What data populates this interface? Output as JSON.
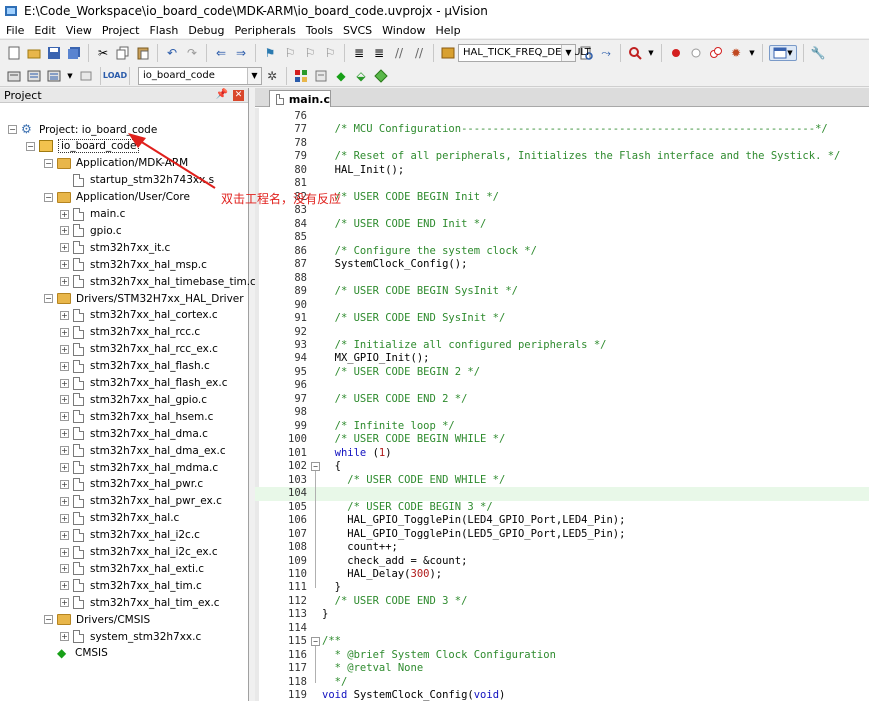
{
  "window": {
    "title": "E:\\Code_Workspace\\io_board_code\\MDK-ARM\\io_board_code.uvprojx - µVision"
  },
  "menu": [
    "File",
    "Edit",
    "View",
    "Project",
    "Flash",
    "Debug",
    "Peripherals",
    "Tools",
    "SVCS",
    "Window",
    "Help"
  ],
  "toolbar1": {
    "define_combo": "HAL_TICK_FREQ_DEFAULT"
  },
  "toolbar2": {
    "target_combo": "io_board_code"
  },
  "project_panel": {
    "title": "Project",
    "items": [
      {
        "label": "Project: io_board_code",
        "kind": "project",
        "level": 0,
        "expander": "−"
      },
      {
        "label": "io_board_code",
        "kind": "target",
        "level": 1,
        "expander": "−"
      },
      {
        "label": "Application/MDK-ARM",
        "kind": "folder",
        "level": 2,
        "expander": "−"
      },
      {
        "label": "startup_stm32h743xx.s",
        "kind": "file",
        "level": 3,
        "expander": ""
      },
      {
        "label": "Application/User/Core",
        "kind": "folder",
        "level": 2,
        "expander": "−"
      },
      {
        "label": "main.c",
        "kind": "file",
        "level": 3,
        "expander": "+"
      },
      {
        "label": "gpio.c",
        "kind": "file",
        "level": 3,
        "expander": "+"
      },
      {
        "label": "stm32h7xx_it.c",
        "kind": "file",
        "level": 3,
        "expander": "+"
      },
      {
        "label": "stm32h7xx_hal_msp.c",
        "kind": "file",
        "level": 3,
        "expander": "+"
      },
      {
        "label": "stm32h7xx_hal_timebase_tim.c",
        "kind": "file",
        "level": 3,
        "expander": "+"
      },
      {
        "label": "Drivers/STM32H7xx_HAL_Driver",
        "kind": "folder",
        "level": 2,
        "expander": "−"
      },
      {
        "label": "stm32h7xx_hal_cortex.c",
        "kind": "file",
        "level": 3,
        "expander": "+"
      },
      {
        "label": "stm32h7xx_hal_rcc.c",
        "kind": "file",
        "level": 3,
        "expander": "+"
      },
      {
        "label": "stm32h7xx_hal_rcc_ex.c",
        "kind": "file",
        "level": 3,
        "expander": "+"
      },
      {
        "label": "stm32h7xx_hal_flash.c",
        "kind": "file",
        "level": 3,
        "expander": "+"
      },
      {
        "label": "stm32h7xx_hal_flash_ex.c",
        "kind": "file",
        "level": 3,
        "expander": "+"
      },
      {
        "label": "stm32h7xx_hal_gpio.c",
        "kind": "file",
        "level": 3,
        "expander": "+"
      },
      {
        "label": "stm32h7xx_hal_hsem.c",
        "kind": "file",
        "level": 3,
        "expander": "+"
      },
      {
        "label": "stm32h7xx_hal_dma.c",
        "kind": "file",
        "level": 3,
        "expander": "+"
      },
      {
        "label": "stm32h7xx_hal_dma_ex.c",
        "kind": "file",
        "level": 3,
        "expander": "+"
      },
      {
        "label": "stm32h7xx_hal_mdma.c",
        "kind": "file",
        "level": 3,
        "expander": "+"
      },
      {
        "label": "stm32h7xx_hal_pwr.c",
        "kind": "file",
        "level": 3,
        "expander": "+"
      },
      {
        "label": "stm32h7xx_hal_pwr_ex.c",
        "kind": "file",
        "level": 3,
        "expander": "+"
      },
      {
        "label": "stm32h7xx_hal.c",
        "kind": "file",
        "level": 3,
        "expander": "+"
      },
      {
        "label": "stm32h7xx_hal_i2c.c",
        "kind": "file",
        "level": 3,
        "expander": "+"
      },
      {
        "label": "stm32h7xx_hal_i2c_ex.c",
        "kind": "file",
        "level": 3,
        "expander": "+"
      },
      {
        "label": "stm32h7xx_hal_exti.c",
        "kind": "file",
        "level": 3,
        "expander": "+"
      },
      {
        "label": "stm32h7xx_hal_tim.c",
        "kind": "file",
        "level": 3,
        "expander": "+"
      },
      {
        "label": "stm32h7xx_hal_tim_ex.c",
        "kind": "file",
        "level": 3,
        "expander": "+"
      },
      {
        "label": "Drivers/CMSIS",
        "kind": "folder",
        "level": 2,
        "expander": "−"
      },
      {
        "label": "system_stm32h7xx.c",
        "kind": "file",
        "level": 3,
        "expander": "+"
      },
      {
        "label": "CMSIS",
        "kind": "cmsis",
        "level": 2,
        "expander": ""
      }
    ]
  },
  "annotation": {
    "text": "双击工程名，没有反应"
  },
  "editor": {
    "active_tab": "main.c",
    "current_line": 104,
    "lines": [
      {
        "n": "76",
        "fold": "",
        "tokens": []
      },
      {
        "n": "77",
        "fold": "",
        "tokens": [
          [
            "comment",
            "  /* MCU Configuration--------------------------------------------------------*/"
          ]
        ]
      },
      {
        "n": "78",
        "fold": "",
        "tokens": []
      },
      {
        "n": "79",
        "fold": "",
        "tokens": [
          [
            "comment",
            "  /* Reset of all peripherals, Initializes the Flash interface and the Systick. */"
          ]
        ]
      },
      {
        "n": "80",
        "fold": "",
        "tokens": [
          [
            "plain",
            "  HAL_Init();"
          ]
        ]
      },
      {
        "n": "81",
        "fold": "",
        "tokens": []
      },
      {
        "n": "82",
        "fold": "",
        "tokens": [
          [
            "comment",
            "  /* USER CODE BEGIN Init */"
          ]
        ]
      },
      {
        "n": "83",
        "fold": "",
        "tokens": []
      },
      {
        "n": "84",
        "fold": "",
        "tokens": [
          [
            "comment",
            "  /* USER CODE END Init */"
          ]
        ]
      },
      {
        "n": "85",
        "fold": "",
        "tokens": []
      },
      {
        "n": "86",
        "fold": "",
        "tokens": [
          [
            "comment",
            "  /* Configure the system clock */"
          ]
        ]
      },
      {
        "n": "87",
        "fold": "",
        "tokens": [
          [
            "plain",
            "  SystemClock_Config();"
          ]
        ]
      },
      {
        "n": "88",
        "fold": "",
        "tokens": []
      },
      {
        "n": "89",
        "fold": "",
        "tokens": [
          [
            "comment",
            "  /* USER CODE BEGIN SysInit */"
          ]
        ]
      },
      {
        "n": "90",
        "fold": "",
        "tokens": []
      },
      {
        "n": "91",
        "fold": "",
        "tokens": [
          [
            "comment",
            "  /* USER CODE END SysInit */"
          ]
        ]
      },
      {
        "n": "92",
        "fold": "",
        "tokens": []
      },
      {
        "n": "93",
        "fold": "",
        "tokens": [
          [
            "comment",
            "  /* Initialize all configured peripherals */"
          ]
        ]
      },
      {
        "n": "94",
        "fold": "",
        "tokens": [
          [
            "plain",
            "  MX_GPIO_Init();"
          ]
        ]
      },
      {
        "n": "95",
        "fold": "",
        "tokens": [
          [
            "comment",
            "  /* USER CODE BEGIN 2 */"
          ]
        ]
      },
      {
        "n": "96",
        "fold": "",
        "tokens": []
      },
      {
        "n": "97",
        "fold": "",
        "tokens": [
          [
            "comment",
            "  /* USER CODE END 2 */"
          ]
        ]
      },
      {
        "n": "98",
        "fold": "",
        "tokens": []
      },
      {
        "n": "99",
        "fold": "",
        "tokens": [
          [
            "comment",
            "  /* Infinite loop */"
          ]
        ]
      },
      {
        "n": "100",
        "fold": "",
        "tokens": [
          [
            "comment",
            "  /* USER CODE BEGIN WHILE */"
          ]
        ]
      },
      {
        "n": "101",
        "fold": "",
        "tokens": [
          [
            "kw",
            "  while"
          ],
          [
            "plain",
            " ("
          ],
          [
            "num",
            "1"
          ],
          [
            "plain",
            ")"
          ]
        ]
      },
      {
        "n": "102",
        "fold": "−",
        "tokens": [
          [
            "plain",
            "  {"
          ]
        ]
      },
      {
        "n": "103",
        "fold": "",
        "tokens": [
          [
            "comment",
            "    /* USER CODE END WHILE */"
          ]
        ]
      },
      {
        "n": "104",
        "fold": "",
        "tokens": []
      },
      {
        "n": "105",
        "fold": "",
        "tokens": [
          [
            "comment",
            "    /* USER CODE BEGIN 3 */"
          ]
        ]
      },
      {
        "n": "106",
        "fold": "",
        "tokens": [
          [
            "plain",
            "    HAL_GPIO_TogglePin(LED4_GPIO_Port,LED4_Pin);"
          ]
        ]
      },
      {
        "n": "107",
        "fold": "",
        "tokens": [
          [
            "plain",
            "    HAL_GPIO_TogglePin(LED5_GPIO_Port,LED5_Pin);"
          ]
        ]
      },
      {
        "n": "108",
        "fold": "",
        "tokens": [
          [
            "plain",
            "    count++;"
          ]
        ]
      },
      {
        "n": "109",
        "fold": "",
        "tokens": [
          [
            "plain",
            "    check_add = &count;"
          ]
        ]
      },
      {
        "n": "110",
        "fold": "",
        "tokens": [
          [
            "plain",
            "    HAL_Delay("
          ],
          [
            "num",
            "300"
          ],
          [
            "plain",
            ");"
          ]
        ]
      },
      {
        "n": "111",
        "fold": "",
        "tokens": [
          [
            "plain",
            "  }"
          ]
        ]
      },
      {
        "n": "112",
        "fold": "",
        "tokens": [
          [
            "comment",
            "  /* USER CODE END 3 */"
          ]
        ]
      },
      {
        "n": "113",
        "fold": "",
        "tokens": [
          [
            "plain",
            "}"
          ]
        ]
      },
      {
        "n": "114",
        "fold": "",
        "tokens": []
      },
      {
        "n": "115",
        "fold": "−",
        "tokens": [
          [
            "comment",
            "/**"
          ]
        ]
      },
      {
        "n": "116",
        "fold": "",
        "tokens": [
          [
            "comment",
            "  * @brief System Clock Configuration"
          ]
        ]
      },
      {
        "n": "117",
        "fold": "",
        "tokens": [
          [
            "comment",
            "  * @retval None"
          ]
        ]
      },
      {
        "n": "118",
        "fold": "",
        "tokens": [
          [
            "comment",
            "  */"
          ]
        ]
      },
      {
        "n": "119",
        "fold": "",
        "tokens": [
          [
            "kw",
            "void"
          ],
          [
            "plain",
            " SystemClock_Config("
          ],
          [
            "kw",
            "void"
          ],
          [
            "plain",
            ")"
          ]
        ]
      }
    ]
  },
  "colors": {
    "comment": "#2e8b2e",
    "keyword": "#1010c0",
    "number": "#b01a1a",
    "annotation": "#e0201c",
    "current_line": "#e8f8e8"
  }
}
